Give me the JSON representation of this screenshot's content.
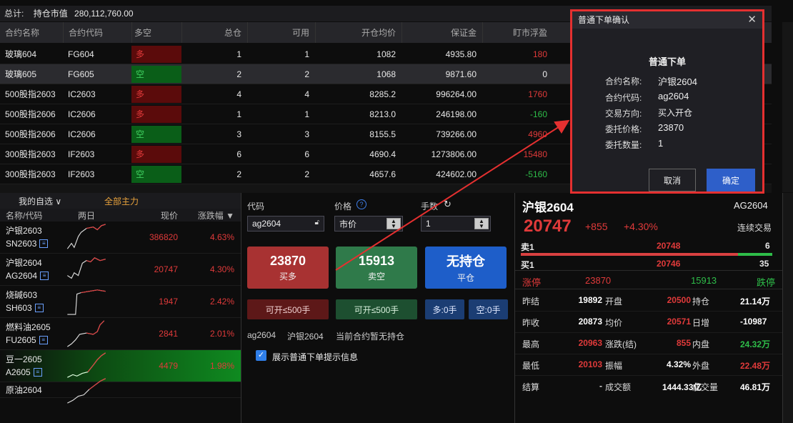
{
  "summary": {
    "label": "总计:",
    "market_value_label": "持仓市值",
    "market_value": "280,112,760.00"
  },
  "table": {
    "headers": [
      "合约名称",
      "合约代码",
      "多空",
      "总仓",
      "可用",
      "开仓均价",
      "保证金",
      "盯市浮盈"
    ],
    "rows": [
      {
        "name": "玻璃604",
        "code": "FG604",
        "dir": "多",
        "total": "1",
        "avail": "1",
        "avg": "1082",
        "margin": "4935.80",
        "pnl": "180",
        "dir_color": "red",
        "pnl_color": "red"
      },
      {
        "name": "玻璃605",
        "code": "FG605",
        "dir": "空",
        "total": "2",
        "avail": "2",
        "avg": "1068",
        "margin": "9871.60",
        "pnl": "0",
        "dir_color": "green",
        "pnl_color": "white"
      },
      {
        "name": "500股指2603",
        "code": "IC2603",
        "dir": "多",
        "total": "4",
        "avail": "4",
        "avg": "8285.2",
        "margin": "996264.00",
        "pnl": "1760",
        "dir_color": "red",
        "pnl_color": "red"
      },
      {
        "name": "500股指2606",
        "code": "IC2606",
        "dir": "多",
        "total": "1",
        "avail": "1",
        "avg": "8213.0",
        "margin": "246198.00",
        "pnl": "-160",
        "dir_color": "red",
        "pnl_color": "green"
      },
      {
        "name": "500股指2606",
        "code": "IC2606",
        "dir": "空",
        "total": "3",
        "avail": "3",
        "avg": "8155.5",
        "margin": "739266.00",
        "pnl": "4960",
        "dir_color": "green",
        "pnl_color": "red"
      },
      {
        "name": "300股指2603",
        "code": "IF2603",
        "dir": "多",
        "total": "6",
        "avail": "6",
        "avg": "4690.4",
        "margin": "1273806.00",
        "pnl": "15480",
        "dir_color": "red",
        "pnl_color": "red"
      },
      {
        "name": "300股指2603",
        "code": "IF2603",
        "dir": "空",
        "total": "2",
        "avail": "2",
        "avg": "4657.6",
        "margin": "424602.00",
        "pnl": "-5160",
        "dir_color": "green",
        "pnl_color": "green"
      }
    ]
  },
  "watchlist": {
    "tab_mine": "我的自选 ∨",
    "tab_all": "全部主力",
    "headers": [
      "名称/代码",
      "两日",
      "现价",
      "涨跌幅 ▼"
    ],
    "items": [
      {
        "name": "沪银2603",
        "code": "SN2603",
        "price": "386820",
        "pct": "4.63%"
      },
      {
        "name": "沪银2604",
        "code": "AG2604",
        "price": "20747",
        "pct": "4.30%"
      },
      {
        "name": "烧碱603",
        "code": "SH603",
        "price": "1947",
        "pct": "2.42%"
      },
      {
        "name": "燃料油2605",
        "code": "FU2605",
        "price": "2841",
        "pct": "2.01%"
      },
      {
        "name": "豆一2605",
        "code": "A2605",
        "price": "4479",
        "pct": "1.98%"
      },
      {
        "name": "原油2604",
        "code": "",
        "price": "",
        "pct": ""
      }
    ]
  },
  "order": {
    "code_label": "代码",
    "price_label": "价格",
    "qty_label": "手数",
    "code_value": "ag2604",
    "price_value": "市价",
    "qty_value": "1",
    "buy_price": "23870",
    "buy_label": "买多",
    "sell_price": "15913",
    "sell_label": "卖空",
    "close_title": "无持仓",
    "close_label": "平仓",
    "can_open_buy": "可开≤500手",
    "can_open_sell": "可开≤500手",
    "long_zero": "多:0手",
    "short_zero": "空:0手",
    "status_code": "ag2604",
    "status_name": "沪银2604",
    "status_text": "当前合约暂无持仓",
    "show_tip": "展示普通下单提示信息"
  },
  "quote": {
    "name": "沪银2604",
    "code": "AG2604",
    "last": "20747",
    "chg": "+855",
    "chg_pct": "+4.30%",
    "session": "连续交易",
    "ask_label": "卖1",
    "ask_price": "20748",
    "ask_vol": "6",
    "bid_label": "买1",
    "bid_price": "20746",
    "bid_vol": "35",
    "limit_up_label": "涨停",
    "limit_up": "23870",
    "limit_down": "15913",
    "limit_down_label": "跌停",
    "rows": [
      {
        "l1": "昨结",
        "v1": "19892",
        "l2": "开盘",
        "v2": "20500",
        "l3": "持仓",
        "v3": "21.14万"
      },
      {
        "l1": "昨收",
        "v1": "20873",
        "l2": "均价",
        "v2": "20571",
        "l3": "日增",
        "v3": "-10987"
      },
      {
        "l1": "最高",
        "v1": "20963",
        "l2": "涨跌(结)",
        "v2": "855",
        "l3": "内盘",
        "v3": "24.32万"
      },
      {
        "l1": "最低",
        "v1": "20103",
        "l2": "振幅",
        "v2": "4.32%",
        "l3": "外盘",
        "v3": "22.48万"
      },
      {
        "l1": "结算",
        "v1": "-",
        "l2": "成交额",
        "v2": "1444.33亿",
        "l3": "成交量",
        "v3": "46.81万"
      }
    ]
  },
  "dialog": {
    "title": "普通下单确认",
    "heading": "普通下单",
    "name_label": "合约名称:",
    "name": "沪银2604",
    "code_label": "合约代码:",
    "code": "ag2604",
    "dir_label": "交易方向:",
    "dir": "买入开仓",
    "price_label": "委托价格:",
    "price": "23870",
    "qty_label": "委托数量:",
    "qty": "1",
    "cancel": "取消",
    "ok": "确定"
  },
  "colors": {
    "red": "#e03a3a",
    "green": "#2ebd49",
    "accent": "#2e5fc9",
    "highlight": "#e53030"
  }
}
